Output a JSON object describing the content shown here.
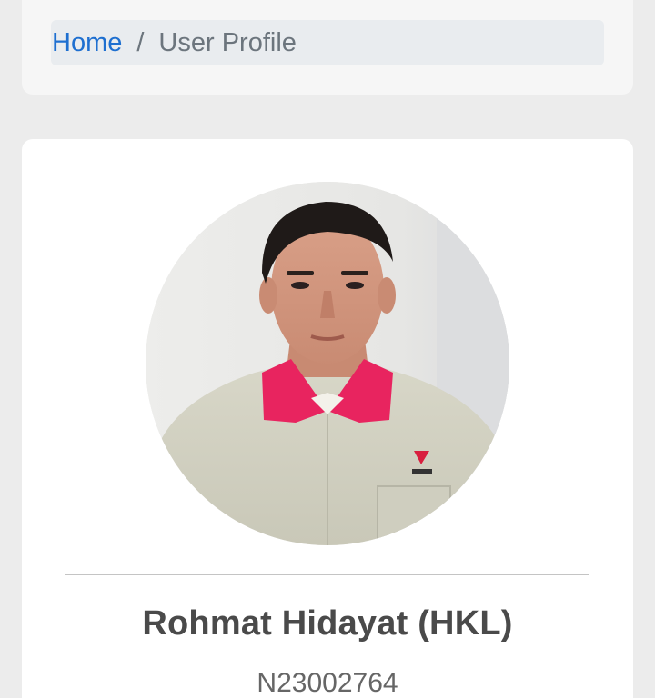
{
  "breadcrumb": {
    "home_label": "Home",
    "separator": "/",
    "current_label": "User Profile"
  },
  "profile": {
    "photo_icon": "avatar-photo",
    "name": "Rohmat Hidayat (HKL)",
    "employee_id": "N23002764"
  },
  "colors": {
    "page_bg": "#ececec",
    "link": "#1e6fd0",
    "breadcrumb_bg": "#e9ecef",
    "text_dark": "#4a4a4a",
    "text_muted": "#6c757d",
    "collar": "#e8245f"
  }
}
